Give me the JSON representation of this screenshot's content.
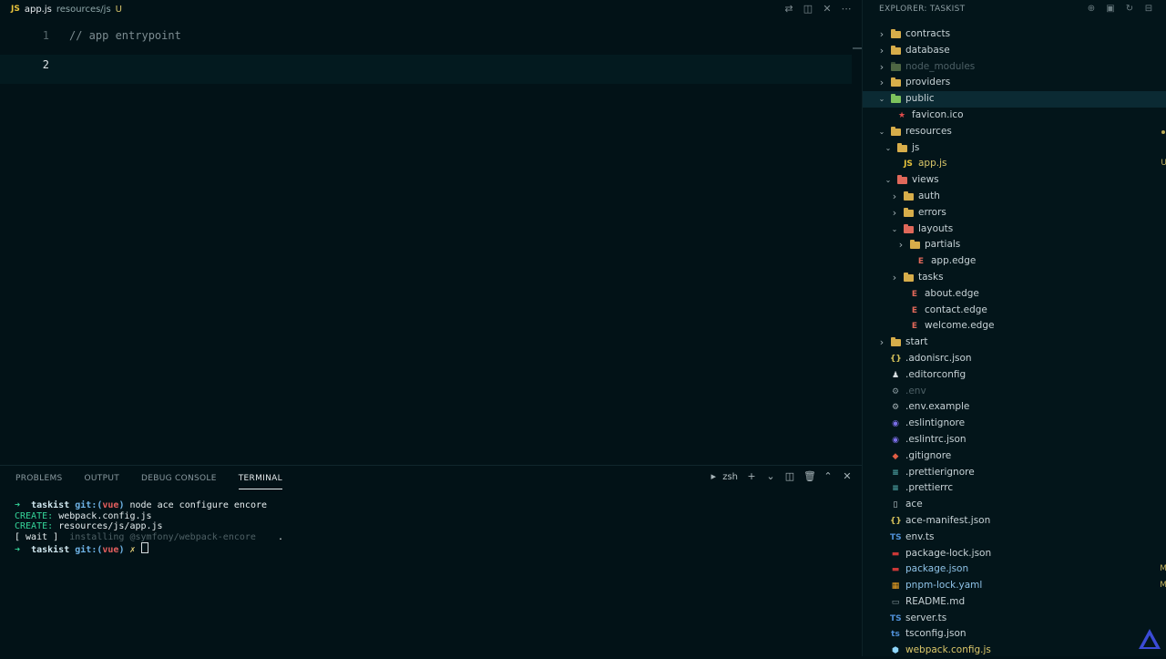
{
  "tab": {
    "icon_label": "JS",
    "filename": "app.js",
    "path": "resources/js",
    "badge": "U"
  },
  "editor": {
    "lines": [
      {
        "number": "1",
        "text": "// app entrypoint"
      },
      {
        "number": "2",
        "text": ""
      }
    ]
  },
  "panel": {
    "tabs": [
      "PROBLEMS",
      "OUTPUT",
      "DEBUG CONSOLE",
      "TERMINAL"
    ],
    "active_tab": "TERMINAL",
    "shell": "zsh"
  },
  "terminal": {
    "prompt_arrow": "➜",
    "project": "taskist",
    "git_prefix": "git:(",
    "branch": "vue",
    "git_suffix": ")",
    "command": "node ace configure encore",
    "create_label": "CREATE:",
    "created": [
      "webpack.config.js",
      "resources/js/app.js"
    ],
    "wait_label": "[ wait ]",
    "wait_text": "installing @symfony/webpack-encore",
    "wait_dot": ".",
    "dirty_mark": "✗"
  },
  "explorer": {
    "title": "EXPLORER: TASKIST",
    "items": [
      {
        "name": "contracts",
        "type": "folder",
        "depth": 0,
        "expanded": false,
        "color": "yellow"
      },
      {
        "name": "database",
        "type": "folder",
        "depth": 0,
        "expanded": false,
        "color": "yellow"
      },
      {
        "name": "node_modules",
        "type": "folder",
        "depth": 0,
        "expanded": false,
        "color": "dim",
        "muted": true
      },
      {
        "name": "providers",
        "type": "folder",
        "depth": 0,
        "expanded": false,
        "color": "yellow"
      },
      {
        "name": "public",
        "type": "folder",
        "depth": 0,
        "expanded": true,
        "color": "green",
        "selected": true
      },
      {
        "name": "favicon.ico",
        "type": "file",
        "depth": 1,
        "icon": "star-icon",
        "icon_glyph": "★",
        "icon_color": "#e04b4b"
      },
      {
        "name": "resources",
        "type": "folder",
        "depth": 0,
        "expanded": true,
        "color": "yellow",
        "dot": true
      },
      {
        "name": "js",
        "type": "folder",
        "depth": 1,
        "expanded": true,
        "color": "yellow"
      },
      {
        "name": "app.js",
        "type": "file",
        "depth": 2,
        "icon": "js-icon",
        "icon_glyph": "JS",
        "icon_color": "#e8c33b",
        "status": "U",
        "name_color": "yellow"
      },
      {
        "name": "views",
        "type": "folder",
        "depth": 1,
        "expanded": true,
        "color": "red"
      },
      {
        "name": "auth",
        "type": "folder",
        "depth": 2,
        "expanded": false,
        "color": "yellow"
      },
      {
        "name": "errors",
        "type": "folder",
        "depth": 2,
        "expanded": false,
        "color": "yellow"
      },
      {
        "name": "layouts",
        "type": "folder",
        "depth": 2,
        "expanded": true,
        "color": "red"
      },
      {
        "name": "partials",
        "type": "folder",
        "depth": 3,
        "expanded": false,
        "color": "yellow"
      },
      {
        "name": "app.edge",
        "type": "file",
        "depth": 4,
        "icon": "edge-icon",
        "icon_glyph": "E",
        "icon_color": "#e0685a"
      },
      {
        "name": "tasks",
        "type": "folder",
        "depth": 2,
        "expanded": false,
        "color": "yellow"
      },
      {
        "name": "about.edge",
        "type": "file",
        "depth": 3,
        "icon": "edge-icon",
        "icon_glyph": "E",
        "icon_color": "#e0685a"
      },
      {
        "name": "contact.edge",
        "type": "file",
        "depth": 3,
        "icon": "edge-icon",
        "icon_glyph": "E",
        "icon_color": "#e0685a"
      },
      {
        "name": "welcome.edge",
        "type": "file",
        "depth": 3,
        "icon": "edge-icon",
        "icon_glyph": "E",
        "icon_color": "#e0685a"
      },
      {
        "name": "start",
        "type": "folder",
        "depth": 0,
        "expanded": false,
        "color": "yellow"
      },
      {
        "name": ".adonisrc.json",
        "type": "file",
        "depth": 0,
        "icon": "json-icon",
        "icon_glyph": "{}",
        "icon_color": "#d6c25a"
      },
      {
        "name": ".editorconfig",
        "type": "file",
        "depth": 0,
        "icon": "editorconfig-icon",
        "icon_glyph": "♟",
        "icon_color": "#d7dde0"
      },
      {
        "name": ".env",
        "type": "file",
        "depth": 0,
        "icon": "gear-icon",
        "icon_glyph": "⚙",
        "icon_color": "#8a9aa0",
        "muted": true
      },
      {
        "name": ".env.example",
        "type": "file",
        "depth": 0,
        "icon": "gear-icon",
        "icon_glyph": "⚙",
        "icon_color": "#aab6ba"
      },
      {
        "name": ".eslintignore",
        "type": "file",
        "depth": 0,
        "icon": "eslint-icon",
        "icon_glyph": "◉",
        "icon_color": "#7b6ee8"
      },
      {
        "name": ".eslintrc.json",
        "type": "file",
        "depth": 0,
        "icon": "eslint-icon",
        "icon_glyph": "◉",
        "icon_color": "#7b6ee8"
      },
      {
        "name": ".gitignore",
        "type": "file",
        "depth": 0,
        "icon": "git-icon",
        "icon_glyph": "◆",
        "icon_color": "#e05d44"
      },
      {
        "name": ".prettierignore",
        "type": "file",
        "depth": 0,
        "icon": "prettier-icon",
        "icon_glyph": "≡",
        "icon_color": "#56b3b4"
      },
      {
        "name": ".prettierrc",
        "type": "file",
        "depth": 0,
        "icon": "prettier-icon",
        "icon_glyph": "≡",
        "icon_color": "#56b3b4"
      },
      {
        "name": "ace",
        "type": "file",
        "depth": 0,
        "icon": "file-icon",
        "icon_glyph": "▯",
        "icon_color": "#c7d2d6"
      },
      {
        "name": "ace-manifest.json",
        "type": "file",
        "depth": 0,
        "icon": "json-icon",
        "icon_glyph": "{}",
        "icon_color": "#d6c25a"
      },
      {
        "name": "env.ts",
        "type": "file",
        "depth": 0,
        "icon": "ts-icon",
        "icon_glyph": "TS",
        "icon_color": "#4f8fd6"
      },
      {
        "name": "package-lock.json",
        "type": "file",
        "depth": 0,
        "icon": "npm-icon",
        "icon_glyph": "▬",
        "icon_color": "#cb3837"
      },
      {
        "name": "package.json",
        "type": "file",
        "depth": 0,
        "icon": "npm-icon",
        "icon_glyph": "▬",
        "icon_color": "#cb3837",
        "status": "M",
        "name_color": "blue"
      },
      {
        "name": "pnpm-lock.yaml",
        "type": "file",
        "depth": 0,
        "icon": "pnpm-icon",
        "icon_glyph": "▦",
        "icon_color": "#f6a623",
        "status": "M",
        "name_color": "blue"
      },
      {
        "name": "README.md",
        "type": "file",
        "depth": 0,
        "icon": "markdown-icon",
        "icon_glyph": "▭",
        "icon_color": "#8a9aa0"
      },
      {
        "name": "server.ts",
        "type": "file",
        "depth": 0,
        "icon": "ts-icon",
        "icon_glyph": "TS",
        "icon_color": "#4f8fd6"
      },
      {
        "name": "tsconfig.json",
        "type": "file",
        "depth": 0,
        "icon": "tsconfig-icon",
        "icon_glyph": "ts",
        "icon_color": "#4f8fd6"
      },
      {
        "name": "webpack.config.js",
        "type": "file",
        "depth": 0,
        "icon": "webpack-icon",
        "icon_glyph": "⬢",
        "icon_color": "#8ed6fb",
        "name_color": "yellow"
      }
    ]
  },
  "colors": {
    "background": "#021217",
    "sidebar": "#03151a",
    "accent_green": "#34d399",
    "folder_yellow": "#d7ad4a"
  }
}
